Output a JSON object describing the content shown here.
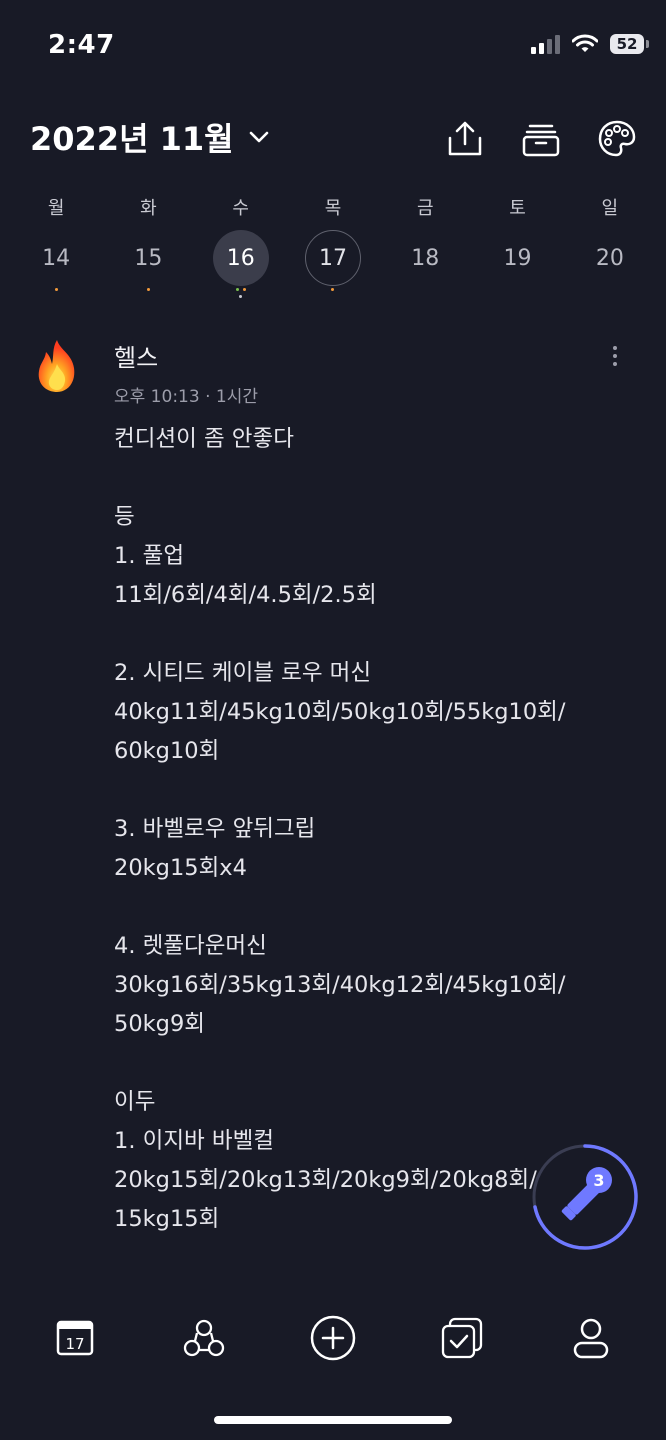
{
  "status_bar": {
    "time": "2:47",
    "battery": "52"
  },
  "header": {
    "month_title": "2022년 11월",
    "icons": [
      "share-icon",
      "archive-icon",
      "palette-icon"
    ]
  },
  "week": {
    "days": [
      {
        "name": "월",
        "num": "14"
      },
      {
        "name": "화",
        "num": "15"
      },
      {
        "name": "수",
        "num": "16"
      },
      {
        "name": "목",
        "num": "17"
      },
      {
        "name": "금",
        "num": "18"
      },
      {
        "name": "토",
        "num": "19"
      },
      {
        "name": "일",
        "num": "20"
      }
    ]
  },
  "entry": {
    "icon": "fire-icon",
    "title": "헬스",
    "meta": "오후 10:13 · 1시간",
    "body": "컨디션이 좀 안좋다\n\n등\n1. 풀업\n11회/6회/4회/4.5회/2.5회\n\n2. 시티드 케이블 로우 머신\n40kg11회/45kg10회/50kg10회/55kg10회/\n60kg10회\n\n3. 바벨로우 앞뒤그립\n20kg15회x4\n\n4. 렛풀다운머신\n30kg16회/35kg13회/40kg12회/45kg10회/\n50kg9회\n\n이두\n1. 이지바 바벨컬\n20kg15회/20kg13회/20kg9회/20kg8회/\n15kg15회"
  },
  "fab": {
    "badge": "3",
    "icon": "pencil-icon"
  },
  "bottom_nav": {
    "calendar_day": "17",
    "items": [
      "calendar-icon",
      "group-icon",
      "add-icon",
      "tasks-icon",
      "profile-icon"
    ]
  },
  "colors": {
    "background": "#181a26",
    "accent": "#6f79ff",
    "dot_orange": "#f29a3b",
    "dot_green": "#7bc24f"
  }
}
